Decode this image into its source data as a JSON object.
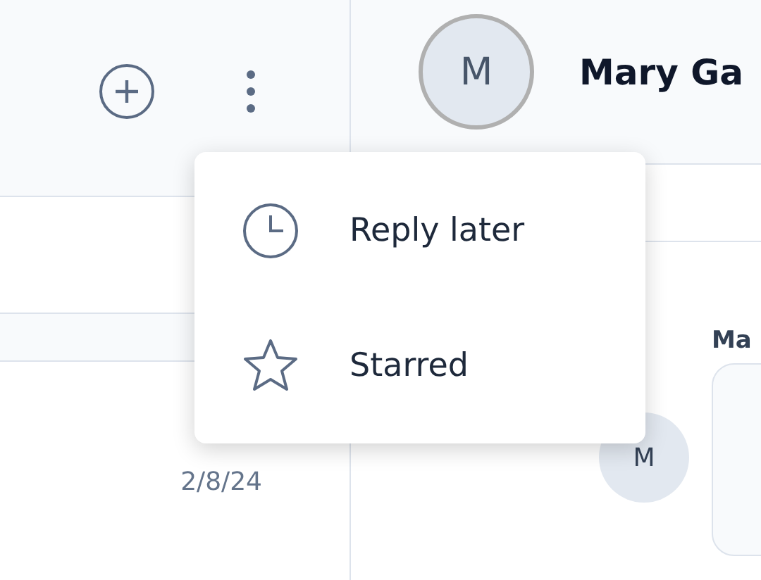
{
  "sidebar": {
    "header_actions": [
      {
        "kind": "add"
      },
      {
        "kind": "more"
      }
    ],
    "conversations": [
      {
        "date": "2/8/24"
      }
    ]
  },
  "conversation": {
    "contact": {
      "initial": "M",
      "name": "Mary Ga"
    },
    "messages": [
      {
        "initial": "M",
        "sender": "Ma"
      }
    ]
  },
  "menu": {
    "items": [
      {
        "kind": "clock",
        "label": "Reply later"
      },
      {
        "kind": "star",
        "label": "Starred"
      }
    ]
  }
}
